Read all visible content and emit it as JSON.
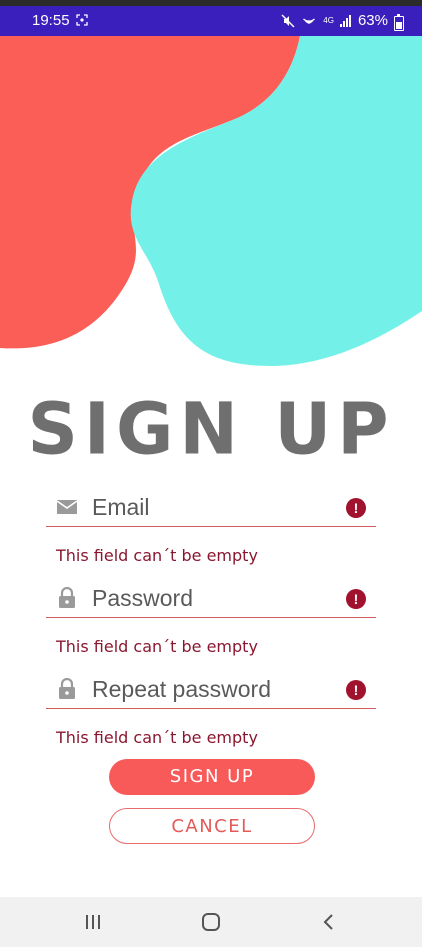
{
  "status_bar": {
    "time": "19:55",
    "network": "4G",
    "battery": "63%",
    "battery_level": 0.63,
    "icons": [
      "screenshot-icon",
      "mute-icon",
      "hotspot-icon",
      "network-4g-icon",
      "signal-icon",
      "battery-icon"
    ]
  },
  "header": {
    "title": "SIGN UP"
  },
  "form": {
    "email": {
      "placeholder": "Email",
      "error": "This field can´t be empty",
      "icon": "email-icon"
    },
    "password": {
      "placeholder": "Password",
      "error": "This field can´t be empty",
      "icon": "lock-icon"
    },
    "repeat_password": {
      "placeholder": "Repeat password",
      "error": "This field can´t be empty",
      "icon": "lock-icon"
    },
    "error_glyph": "!"
  },
  "buttons": {
    "signup": "SIGN UP",
    "cancel": "CANCEL"
  },
  "colors": {
    "status_bar": "#3a1fbd",
    "blob_red": "#fb5d57",
    "blob_cyan": "#73f1e9",
    "title": "#6f6f6f",
    "error": "#8a1730",
    "button_primary": "#f75a58"
  },
  "nav_bar": {
    "icons": [
      "recent-apps-icon",
      "home-icon",
      "back-icon"
    ]
  }
}
